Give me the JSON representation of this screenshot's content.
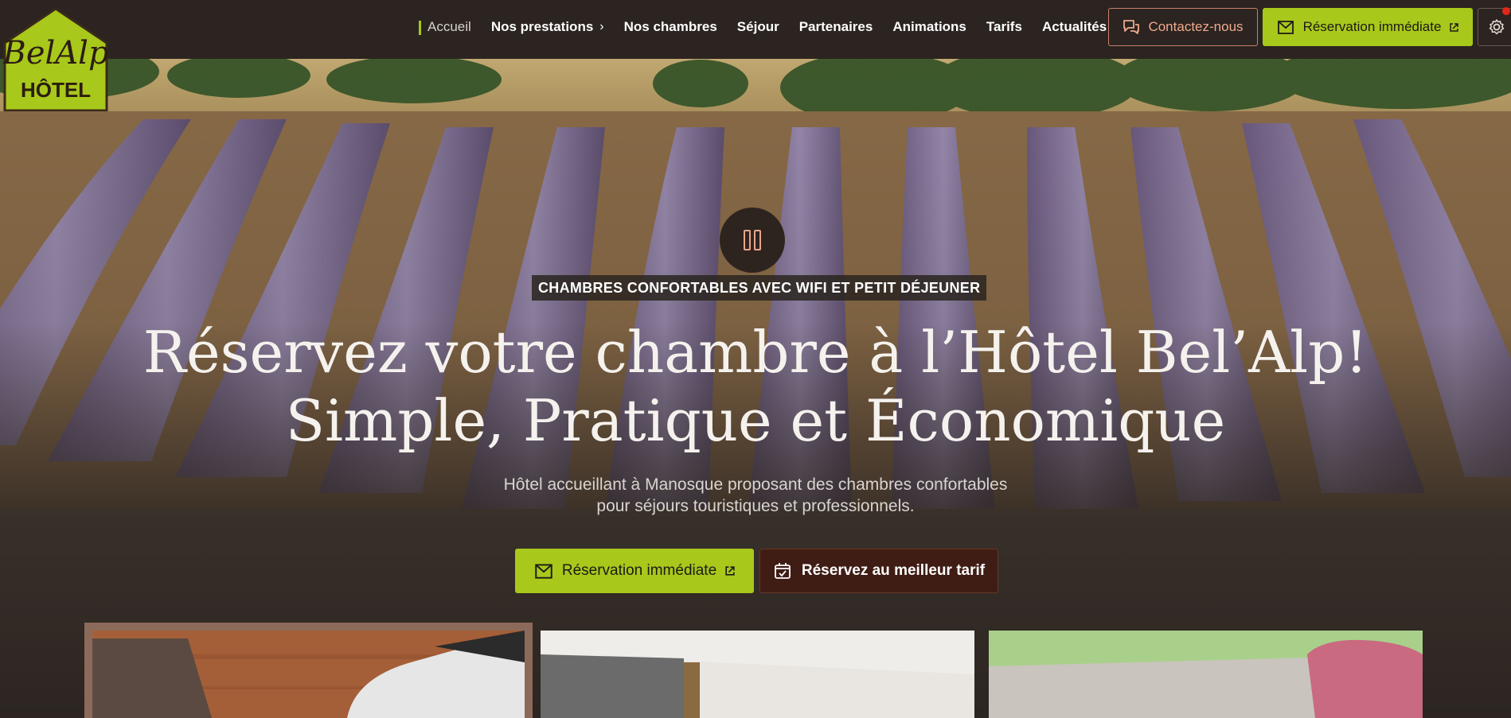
{
  "brand": {
    "logo_top": "BelAlp",
    "logo_bottom": "HÔTEL"
  },
  "nav": {
    "items": [
      {
        "label": "Accueil",
        "active": true
      },
      {
        "label": "Nos prestations",
        "has_submenu": true
      },
      {
        "label": "Nos chambres"
      },
      {
        "label": "Séjour"
      },
      {
        "label": "Partenaires"
      },
      {
        "label": "Animations"
      },
      {
        "label": "Tarifs"
      },
      {
        "label": "Actualités"
      }
    ],
    "contact_label": "Contactez-nous",
    "reserve_label": "Réservation immédiate"
  },
  "hero": {
    "badge": "CHAMBRES CONFORTABLES AVEC WIFI ET PETIT DÉJEUNER",
    "headline_line1": "Réservez votre chambre à l’Hôtel Bel’Alp!",
    "headline_line2": "Simple, Pratique et Économique",
    "subtext_line1": "Hôtel accueillant à Manosque proposant des chambres confortables",
    "subtext_line2": "pour séjours touristiques et professionnels.",
    "cta_primary": "Réservation immédiate",
    "cta_secondary": "Réservez au meilleur tarif"
  },
  "colors": {
    "accent_green": "#a8c81b",
    "dark_brown": "#2b2420",
    "contact_orange": "#f0a98e",
    "notification_red": "#e32618"
  },
  "icons": [
    "pause-icon",
    "chat-icon",
    "booking-icon",
    "external-link-icon",
    "settings-icon",
    "calendar-check-icon",
    "chevron-right-icon"
  ]
}
